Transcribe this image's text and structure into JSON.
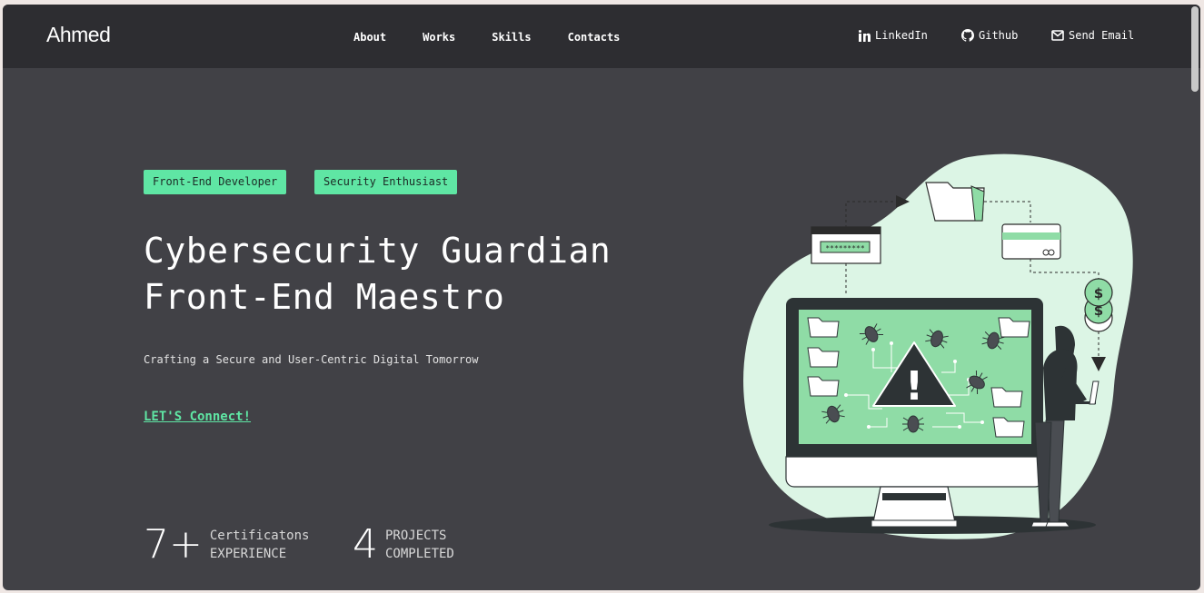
{
  "nav": {
    "brand": "Ahmed",
    "links": [
      "About",
      "Works",
      "Skills",
      "Contacts"
    ],
    "social": [
      {
        "label": "LinkedIn",
        "icon": "linkedin-icon"
      },
      {
        "label": "Github",
        "icon": "github-icon"
      },
      {
        "label": "Send Email",
        "icon": "envelope-icon"
      }
    ]
  },
  "hero": {
    "tags": [
      "Front-End Developer",
      "Security Enthusiast"
    ],
    "headline_line1": "Cybersecurity Guardian",
    "headline_line2": "Front-End Maestro",
    "subtitle": "Crafting a Secure and User-Centric Digital Tomorrow",
    "cta": "LET'S Connect!"
  },
  "stats": [
    {
      "number": "7+",
      "label_line1": "Certificatons",
      "label_line2": "EXPERIENCE"
    },
    {
      "number": "4",
      "label_line1": "PROJECTS",
      "label_line2": "COMPLETED"
    }
  ],
  "illustration": {
    "password_mask": "*********",
    "coin_symbol": "$",
    "warning_symbol": "!"
  },
  "colors": {
    "accent": "#5fe6a4",
    "page_bg": "#414146",
    "nav_bg": "#2d2d31"
  }
}
